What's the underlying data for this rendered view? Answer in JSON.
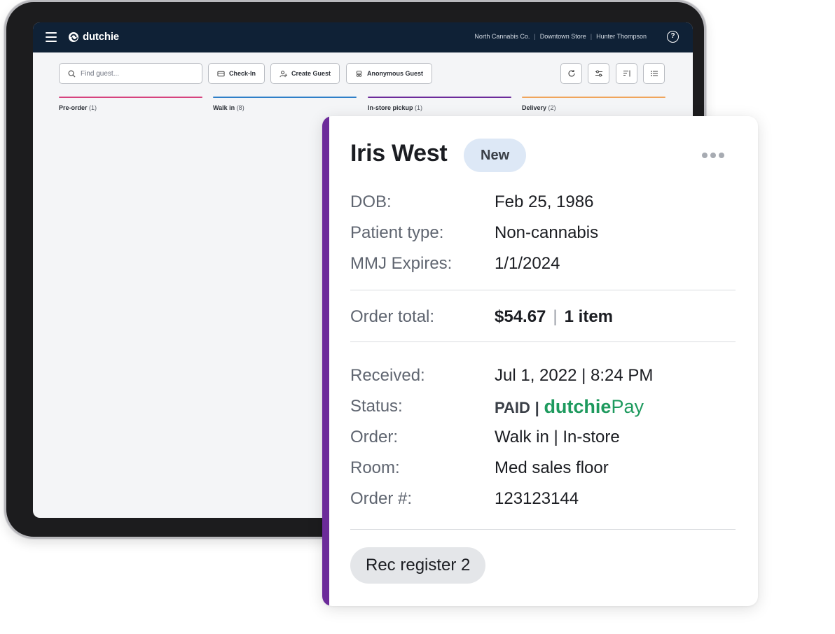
{
  "app": {
    "brand": "dutchie",
    "company": "North Cannabis Co.",
    "store": "Downtown Store",
    "user": "Hunter Thompson",
    "help_label": "?"
  },
  "toolbar": {
    "search_placeholder": "Find guest...",
    "checkin_label": "Check-In",
    "create_guest_label": "Create Guest",
    "anonymous_guest_label": "Anonymous Guest",
    "icon_buttons": [
      "refresh-icon",
      "filter-sliders-icon",
      "sort-icon",
      "list-view-icon"
    ]
  },
  "columns": [
    {
      "title": "Pre-order",
      "count": "(1)",
      "color": "#d6437e"
    },
    {
      "title": "Walk in",
      "count": "(8)",
      "color": "#2f7fc8"
    },
    {
      "title": "In-store pickup",
      "count": "(1)",
      "color": "#6c2b9a"
    },
    {
      "title": "Delivery",
      "count": "(2)",
      "color": "#f0a55c"
    }
  ],
  "card": {
    "accent_color": "#6c2b9a",
    "name": "Iris West",
    "badge": "New",
    "dob_label": "DOB:",
    "dob": "Feb 25, 1986",
    "patient_type_label": "Patient type:",
    "patient_type": "Non-cannabis",
    "mmj_label": "MMJ Expires:",
    "mmj_expires": "1/1/2024",
    "order_total_label": "Order total:",
    "order_total": "$54.67",
    "order_sep": "|",
    "item_count": "1 item",
    "received_label": "Received:",
    "received": "Jul 1, 2022 | 8:24 PM",
    "status_label": "Status:",
    "status_paid": "PAID",
    "status_sep": "|",
    "pay_brand_bold": "dutchie",
    "pay_brand_light": "Pay",
    "order_label": "Order:",
    "order": "Walk in | In-store",
    "room_label": "Room:",
    "room": "Med sales floor",
    "order_number_label": "Order #:",
    "order_number": "123123144",
    "register": "Rec register 2"
  }
}
